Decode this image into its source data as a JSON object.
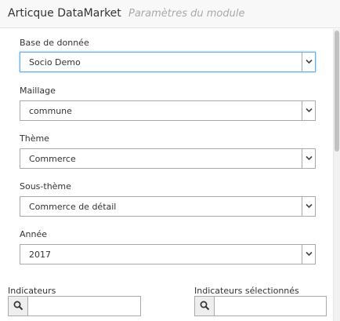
{
  "header": {
    "title": "Articque DataMarket",
    "subtitle": "Paramètres du module"
  },
  "form": {
    "database": {
      "label": "Base de donnée",
      "value": "Socio Demo"
    },
    "mesh": {
      "label": "Maillage",
      "value": "commune"
    },
    "theme": {
      "label": "Thème",
      "value": "Commerce"
    },
    "subtheme": {
      "label": "Sous-thème",
      "value": "Commerce de détail"
    },
    "year": {
      "label": "Année",
      "value": "2017"
    }
  },
  "indicators": {
    "available": {
      "label": "Indicateurs",
      "search_value": ""
    },
    "selected": {
      "label": "Indicateurs sélectionnés",
      "search_value": ""
    }
  },
  "icons": {
    "dropdown": "chevron-down-icon",
    "search": "search-icon"
  },
  "colors": {
    "focus_border": "#66afe9",
    "header_bg": "#f8f8f8"
  }
}
